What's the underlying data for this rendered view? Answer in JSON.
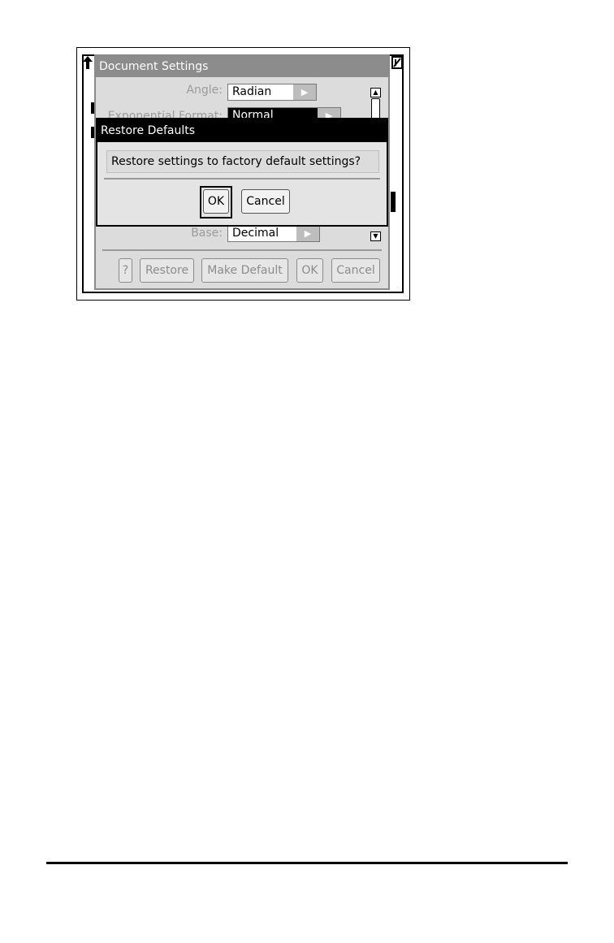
{
  "document_settings": {
    "title": "Document Settings",
    "rows": [
      {
        "label": "Angle:",
        "value": "Radian"
      },
      {
        "label": "Exponential Format:",
        "value": "Normal"
      },
      {
        "label": "Base:",
        "value": "Decimal"
      }
    ],
    "buttons": {
      "help": "?",
      "restore": "Restore",
      "make_default": "Make Default",
      "ok": "OK",
      "cancel": "Cancel"
    }
  },
  "restore_dialog": {
    "title": "Restore Defaults",
    "message": "Restore settings to factory default settings?",
    "ok": "OK",
    "cancel": "Cancel"
  },
  "icons": {
    "arrow": "triangle-right-icon",
    "scroll_up": "scroll-up-icon",
    "scroll_down": "scroll-down-icon"
  }
}
